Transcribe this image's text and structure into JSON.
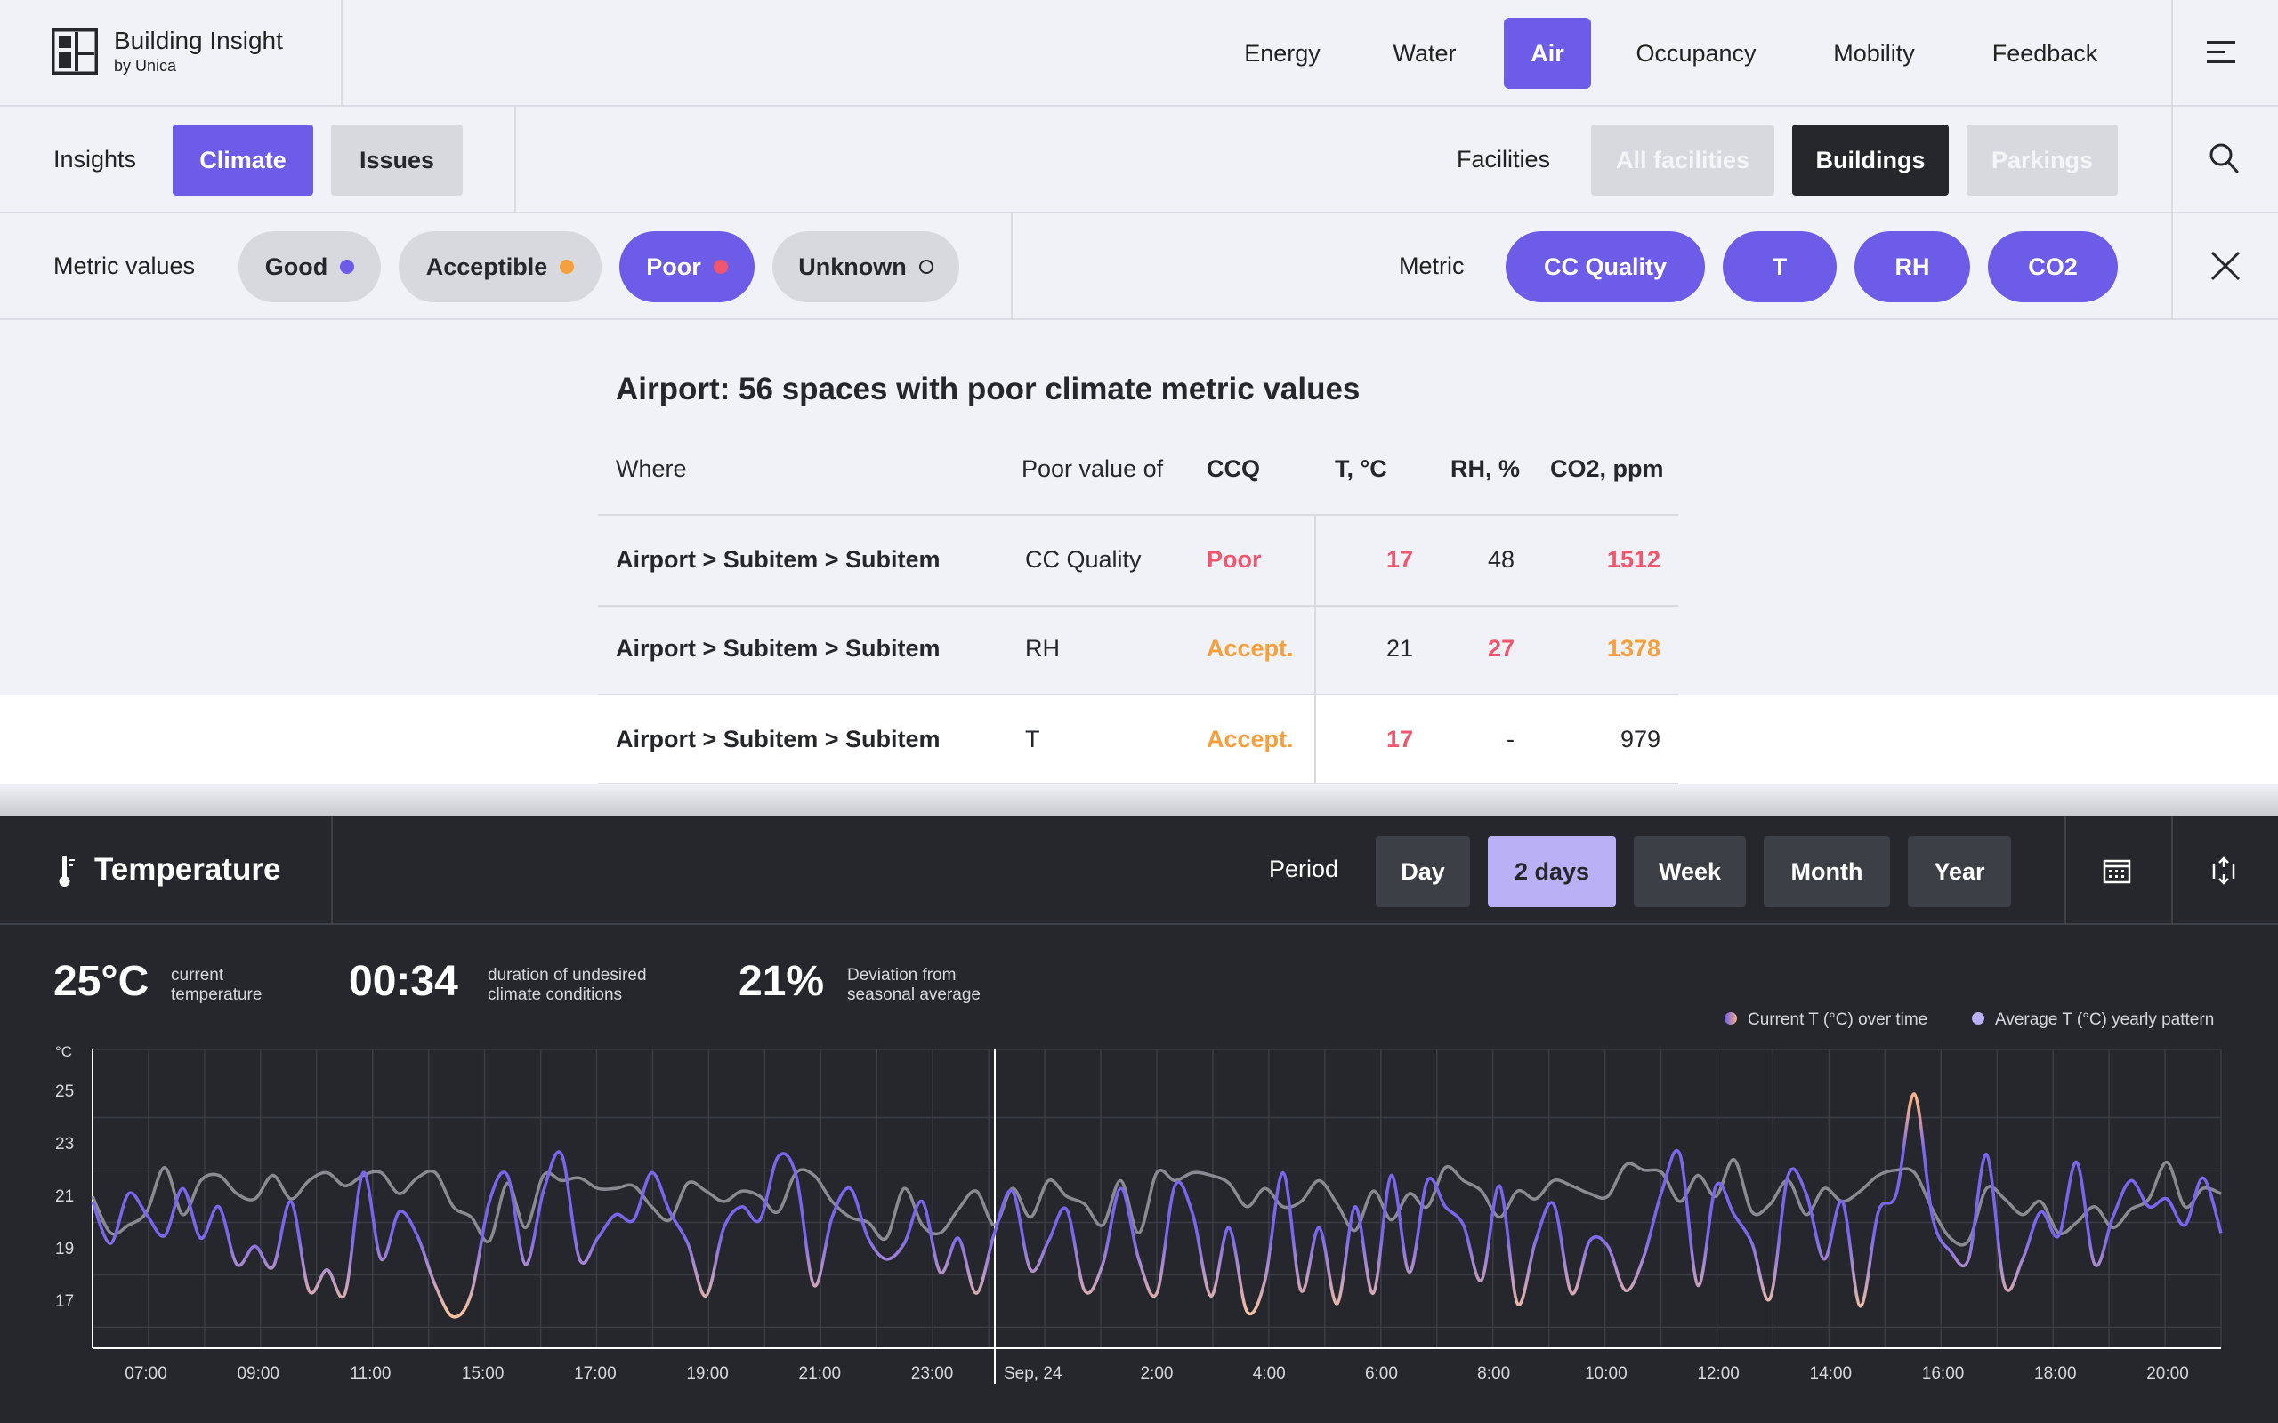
{
  "header": {
    "brand_name": "Building Insight",
    "brand_sub": "by Unica",
    "nav": [
      "Energy",
      "Water",
      "Air",
      "Occupancy",
      "Mobility",
      "Feedback"
    ],
    "active_nav": "Air"
  },
  "subnav": {
    "insights_label": "Insights",
    "tabs": [
      "Climate",
      "Issues"
    ],
    "facilities_label": "Facilities",
    "facilities": [
      "All facilities",
      "Buildings",
      "Parkings"
    ]
  },
  "filters": {
    "metric_values_label": "Metric values",
    "values": [
      {
        "label": "Good",
        "color": "#6c5ce7"
      },
      {
        "label": "Acceptible",
        "color": "#f5a03c"
      },
      {
        "label": "Poor",
        "color": "#f0566e"
      },
      {
        "label": "Unknown",
        "color": "#26272b"
      }
    ],
    "metric_label": "Metric",
    "metrics": [
      "CC Quality",
      "T",
      "RH",
      "CO2"
    ]
  },
  "table": {
    "title": "Airport: 56 spaces with poor climate metric values",
    "headers": [
      "Where",
      "Poor value of",
      "CCQ",
      "T, °C",
      "RH, %",
      "CO2, ppm"
    ],
    "rows": [
      {
        "where": "Airport > Subitem > Subitem",
        "poor": "CC Quality",
        "ccq": "Poor",
        "t": "17",
        "rh": "48",
        "co2": "1512"
      },
      {
        "where": "Airport > Subitem > Subitem",
        "poor": "RH",
        "ccq": "Accept.",
        "t": "21",
        "rh": "27",
        "co2": "1378"
      },
      {
        "where": "Airport > Subitem > Subitem",
        "poor": "T",
        "ccq": "Accept.",
        "t": "17",
        "rh": "-",
        "co2": "979"
      }
    ]
  },
  "panel": {
    "title": "Temperature",
    "period_label": "Period",
    "periods": [
      "Day",
      "2 days",
      "Week",
      "Month",
      "Year"
    ],
    "active_period": "2 days",
    "stats": [
      {
        "value": "25°C",
        "desc1": "current",
        "desc2": "temperature"
      },
      {
        "value": "00:34",
        "desc1": "duration of undesired",
        "desc2": "climate conditions"
      },
      {
        "value": "21%",
        "desc1": "Deviation from",
        "desc2": "seasonal average"
      }
    ],
    "legend": [
      {
        "label": "Current T (°C) over time",
        "color": "#8a7af0"
      },
      {
        "label": "Average T (°C) yearly pattern",
        "color": "#b9b0f5"
      }
    ]
  },
  "chart_data": {
    "type": "line",
    "ylabel": "°C",
    "ylim": [
      15.2,
      26.6
    ],
    "yticks": [
      17,
      19,
      21,
      23,
      25
    ],
    "x_tick_labels": [
      "07:00",
      "09:00",
      "11:00",
      "15:00",
      "17:00",
      "19:00",
      "21:00",
      "23:00",
      "Sep, 24",
      "2:00",
      "4:00",
      "6:00",
      "8:00",
      "10:00",
      "12:00",
      "14:00",
      "16:00",
      "18:00",
      "20:00"
    ],
    "grid": true,
    "threshold_high": 22,
    "threshold_low": 18.5,
    "series": [
      {
        "name": "Current T (°C) over time",
        "values": [
          20.8,
          19.2,
          21.1,
          20.3,
          19.5,
          21.3,
          19.4,
          20.6,
          18.4,
          19.1,
          18.3,
          20.8,
          17.4,
          18.2,
          17.3,
          21.9,
          18.6,
          20.4,
          19.5,
          17.6,
          16.4,
          17.3,
          20.8,
          21.8,
          18.4,
          21.2,
          22.6,
          18.6,
          19.4,
          20.3,
          20.1,
          21.9,
          20.4,
          19.2,
          17.2,
          19.8,
          20.6,
          20.1,
          22.5,
          21.8,
          17.6,
          20.2,
          21.3,
          19.4,
          18.6,
          19.2,
          20.8,
          18.1,
          19.4,
          17.3,
          19.6,
          21.2,
          18.2,
          19.3,
          20.5,
          17.4,
          18.4,
          21.3,
          18.6,
          17.3,
          21.4,
          20.3,
          17.2,
          19.8,
          16.6,
          17.8,
          21.9,
          17.4,
          19.8,
          16.9,
          20.6,
          17.3,
          21.8,
          18.1,
          21.6,
          20.6,
          19.9,
          17.8,
          21.4,
          16.9,
          19.3,
          20.7,
          17.3,
          19.3,
          19.1,
          17.4,
          18.7,
          21.2,
          22.6,
          17.6,
          21.4,
          20.3,
          19.2,
          17.1,
          21.8,
          21.1,
          18.6,
          20.8,
          16.8,
          20.4,
          21.1,
          24.9,
          20.2,
          18.9,
          18.6,
          22.6,
          17.6,
          18.6,
          20.4,
          19.5,
          22.3,
          18.4,
          20.2,
          21.6,
          20.6,
          20.9,
          19.9,
          21.7,
          19.6
        ]
      },
      {
        "name": "Average T (°C) yearly pattern",
        "values": [
          21.0,
          19.6,
          19.9,
          20.4,
          22.1,
          20.3,
          21.6,
          21.8,
          21.1,
          20.9,
          21.8,
          20.9,
          21.6,
          21.9,
          21.4,
          21.8,
          21.9,
          21.1,
          21.7,
          21.9,
          20.6,
          20.2,
          19.3,
          21.5,
          19.8,
          21.8,
          21.6,
          21.7,
          21.3,
          21.3,
          21.4,
          20.6,
          20.1,
          21.5,
          21.2,
          20.8,
          21.2,
          21.0,
          20.4,
          21.9,
          21.8,
          20.8,
          20.2,
          20.0,
          19.4,
          21.3,
          19.9,
          19.6,
          20.5,
          21.2,
          19.9,
          21.3,
          20.2,
          21.6,
          21.0,
          20.7,
          19.9,
          21.6,
          19.6,
          21.9,
          21.6,
          21.9,
          21.8,
          21.5,
          20.6,
          21.3,
          20.6,
          20.8,
          21.6,
          20.7,
          19.7,
          21.2,
          20.1,
          21.1,
          20.6,
          22.1,
          21.6,
          21.2,
          20.2,
          21.2,
          20.9,
          21.6,
          21.4,
          21.1,
          21.0,
          22.2,
          22.0,
          21.9,
          20.8,
          21.8,
          21.0,
          22.4,
          20.4,
          20.7,
          21.6,
          20.3,
          21.3,
          20.8,
          21.2,
          21.8,
          22.0,
          21.9,
          20.5,
          19.4,
          19.3,
          21.3,
          20.9,
          20.3,
          20.8,
          19.6,
          20.0,
          20.6,
          19.8,
          20.5,
          20.9,
          22.3,
          20.6,
          21.3,
          21.1
        ]
      }
    ]
  }
}
